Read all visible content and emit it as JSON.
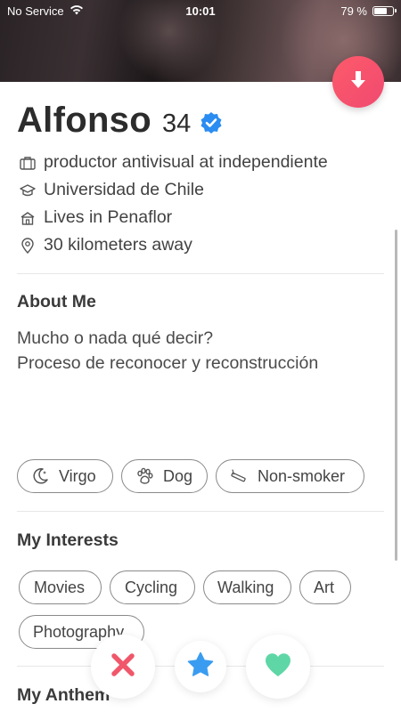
{
  "status_bar": {
    "carrier": "No Service",
    "time": "10:01",
    "battery_text": "79 %",
    "battery_level": 0.79
  },
  "profile": {
    "name": "Alfonso",
    "age": "34",
    "job": "productor antivisual at independiente",
    "school": "Universidad de Chile",
    "location": "Lives in Penaflor",
    "distance": "30 kilometers away"
  },
  "about": {
    "title": "About Me",
    "line1": "Mucho o nada qué decir?",
    "line2": "Proceso de reconocer y reconstrucción"
  },
  "basics": [
    {
      "label": "Virgo",
      "icon": "moon-icon"
    },
    {
      "label": "Dog",
      "icon": "paw-icon"
    },
    {
      "label": "Non-smoker",
      "icon": "no-smoking-icon"
    }
  ],
  "interests": {
    "title": "My Interests",
    "items": [
      "Movies",
      "Cycling",
      "Walking",
      "Art",
      "Photography"
    ]
  },
  "anthem": {
    "title": "My Anthem"
  },
  "colors": {
    "accent": "#fd5a6a",
    "nope": "#f0576a",
    "superlike": "#3a9cf0",
    "like": "#5fd6a6",
    "verified": "#2b8cf2"
  }
}
